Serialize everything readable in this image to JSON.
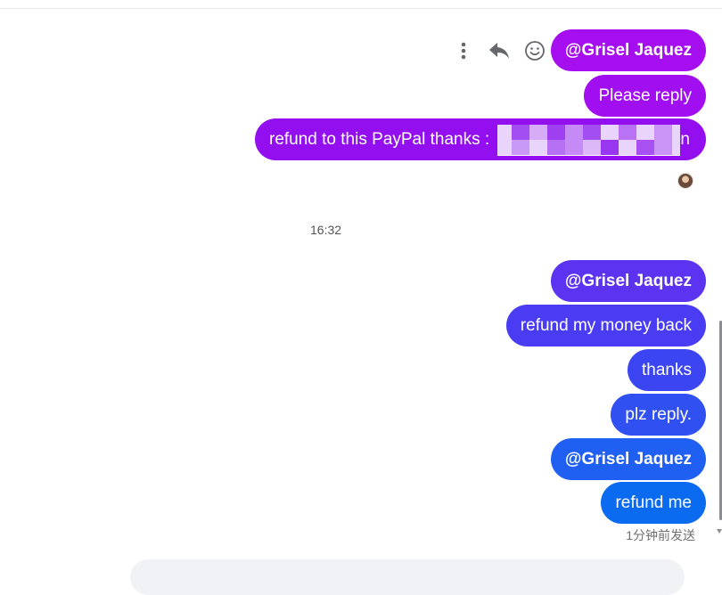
{
  "messages": [
    {
      "text": "@Grisel Jaquez",
      "mention": true,
      "color": "#a50ff0"
    },
    {
      "text": "Please reply",
      "mention": false,
      "color": "#a10ef0"
    },
    {
      "text": "refund to this PayPal  thanks : ",
      "redacted_suffix": "n",
      "mention": false,
      "color": "#930ff0"
    },
    {
      "text": "@Grisel Jaquez",
      "mention": true,
      "color": "#5d33f2"
    },
    {
      "text": "refund my money back",
      "mention": false,
      "color": "#4a3cf2"
    },
    {
      "text": "thanks",
      "mention": false,
      "color": "#3b45f2"
    },
    {
      "text": "plz reply.",
      "mention": false,
      "color": "#3150f2"
    },
    {
      "text": "@Grisel Jaquez",
      "mention": true,
      "color": "#1f5ff2"
    },
    {
      "text": "refund me",
      "mention": false,
      "color": "#0a6bf0"
    }
  ],
  "message_actions": [
    {
      "icon": "more-vertical-icon"
    },
    {
      "icon": "reply-icon"
    },
    {
      "icon": "smiley-icon"
    }
  ],
  "timestamp": "16:32",
  "sent_status": "1分钟前发送"
}
